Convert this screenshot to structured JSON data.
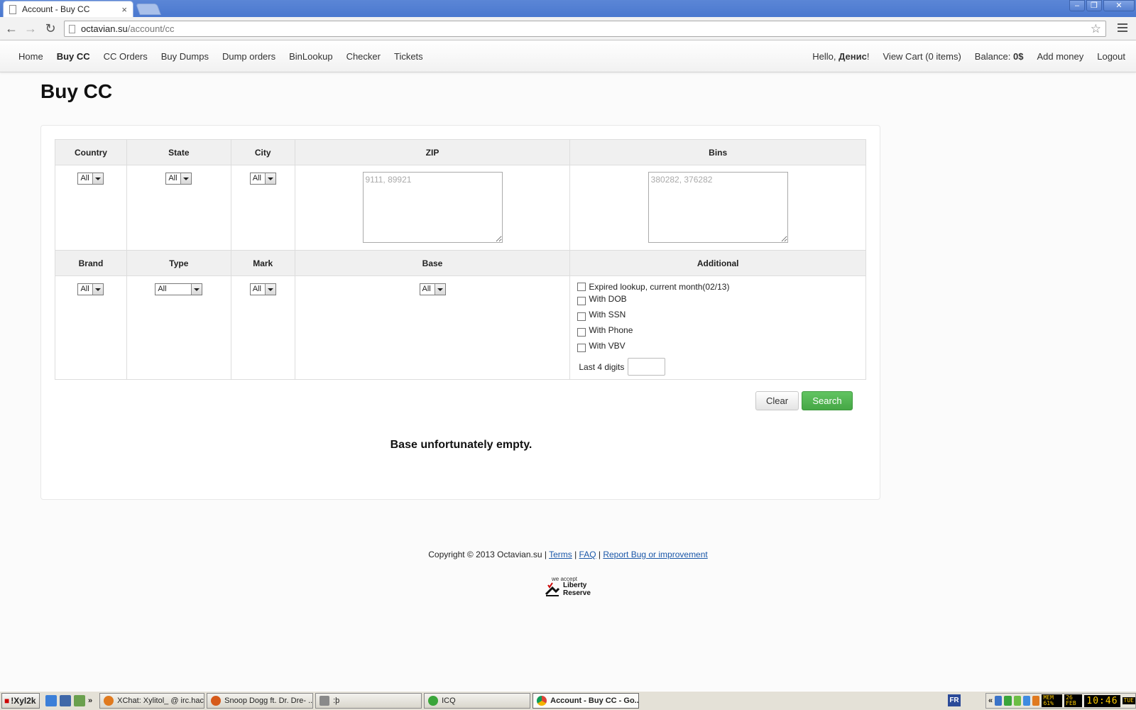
{
  "browser": {
    "tab_title": "Account - Buy CC",
    "tab_close": "×",
    "url_host": "octavian.su",
    "url_path": "/account/cc",
    "window_controls": [
      "–",
      "❐",
      "✕"
    ]
  },
  "nav": {
    "left": [
      "Home",
      "Buy CC",
      "CC Orders",
      "Buy Dumps",
      "Dump orders",
      "BinLookup",
      "Checker",
      "Tickets"
    ],
    "active": "Buy CC",
    "greeting_prefix": "Hello, ",
    "user_name": "Денис",
    "greeting_suffix": "!",
    "view_cart": "View Cart (0 items)",
    "balance_label": "Balance: ",
    "balance_value": "0$",
    "add_money": "Add money",
    "logout": "Logout"
  },
  "page_title": "Buy CC",
  "filters": {
    "headers_row1": [
      "Country",
      "State",
      "City",
      "ZIP",
      "Bins"
    ],
    "headers_row2": [
      "Brand",
      "Type",
      "Mark",
      "Base",
      "Additional"
    ],
    "select_all": "All",
    "zip_placeholder": "9111, 89921",
    "bins_placeholder": "380282, 376282",
    "checkboxes": [
      "Expired lookup, current month(02/13)",
      "With DOB",
      "With SSN",
      "With Phone",
      "With VBV"
    ],
    "last4_label": "Last 4 digits"
  },
  "buttons": {
    "clear": "Clear",
    "search": "Search"
  },
  "empty_message": "Base unfortunately empty.",
  "footer": {
    "copyright": "Copyright © 2013 Octavian.su | ",
    "terms": "Terms",
    "sep1": " | ",
    "faq": "FAQ",
    "sep2": " | ",
    "report": "Report Bug or improvement",
    "accept_small": "we accept",
    "accept_brand_1": "Liberty",
    "accept_brand_2": "Reserve"
  },
  "taskbar": {
    "start": "!Xyl2k",
    "tasks": [
      "XChat: Xylitol_ @ irc.hac...",
      "Snoop Dogg ft. Dr. Dre- ...",
      ":þ",
      "ICQ",
      "Account - Buy CC - Go..."
    ],
    "lang": "FR",
    "mem": "MEM 61%",
    "date": "26 FEB",
    "clock": "10:46",
    "day": "TUE",
    "tray_arrow": "«",
    "quicklaunch_more": "»"
  },
  "colors": {
    "search_button": "#45a745",
    "link": "#1a57a8",
    "titlebar": "#4a78cf"
  }
}
